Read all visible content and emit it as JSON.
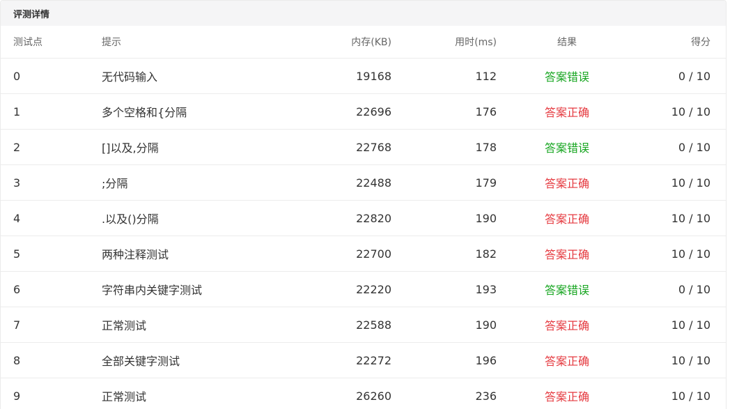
{
  "panel": {
    "title": "评测详情"
  },
  "table": {
    "headers": {
      "id": "测试点",
      "hint": "提示",
      "memory": "内存(KB)",
      "time": "用时(ms)",
      "result": "结果",
      "score": "得分"
    },
    "rows": [
      {
        "id": "0",
        "hint": "无代码输入",
        "memory": "19168",
        "time": "112",
        "result": "答案错误",
        "score": "0 / 10"
      },
      {
        "id": "1",
        "hint": "多个空格和{分隔",
        "memory": "22696",
        "time": "176",
        "result": "答案正确",
        "score": "10 / 10"
      },
      {
        "id": "2",
        "hint": "[]以及,分隔",
        "memory": "22768",
        "time": "178",
        "result": "答案错误",
        "score": "0 / 10"
      },
      {
        "id": "3",
        "hint": ";分隔",
        "memory": "22488",
        "time": "179",
        "result": "答案正确",
        "score": "10 / 10"
      },
      {
        "id": "4",
        "hint": ".以及()分隔",
        "memory": "22820",
        "time": "190",
        "result": "答案正确",
        "score": "10 / 10"
      },
      {
        "id": "5",
        "hint": "两种注释测试",
        "memory": "22700",
        "time": "182",
        "result": "答案正确",
        "score": "10 / 10"
      },
      {
        "id": "6",
        "hint": "字符串内关键字测试",
        "memory": "22220",
        "time": "193",
        "result": "答案错误",
        "score": "0 / 10"
      },
      {
        "id": "7",
        "hint": "正常测试",
        "memory": "22588",
        "time": "190",
        "result": "答案正确",
        "score": "10 / 10"
      },
      {
        "id": "8",
        "hint": "全部关键字测试",
        "memory": "22272",
        "time": "196",
        "result": "答案正确",
        "score": "10 / 10"
      },
      {
        "id": "9",
        "hint": "正常测试",
        "memory": "26260",
        "time": "236",
        "result": "答案正确",
        "score": "10 / 10"
      }
    ]
  },
  "colors": {
    "accepted": "#e5393f",
    "wrong_answer": "#15a51f",
    "header_bg": "#f5f5f6"
  }
}
